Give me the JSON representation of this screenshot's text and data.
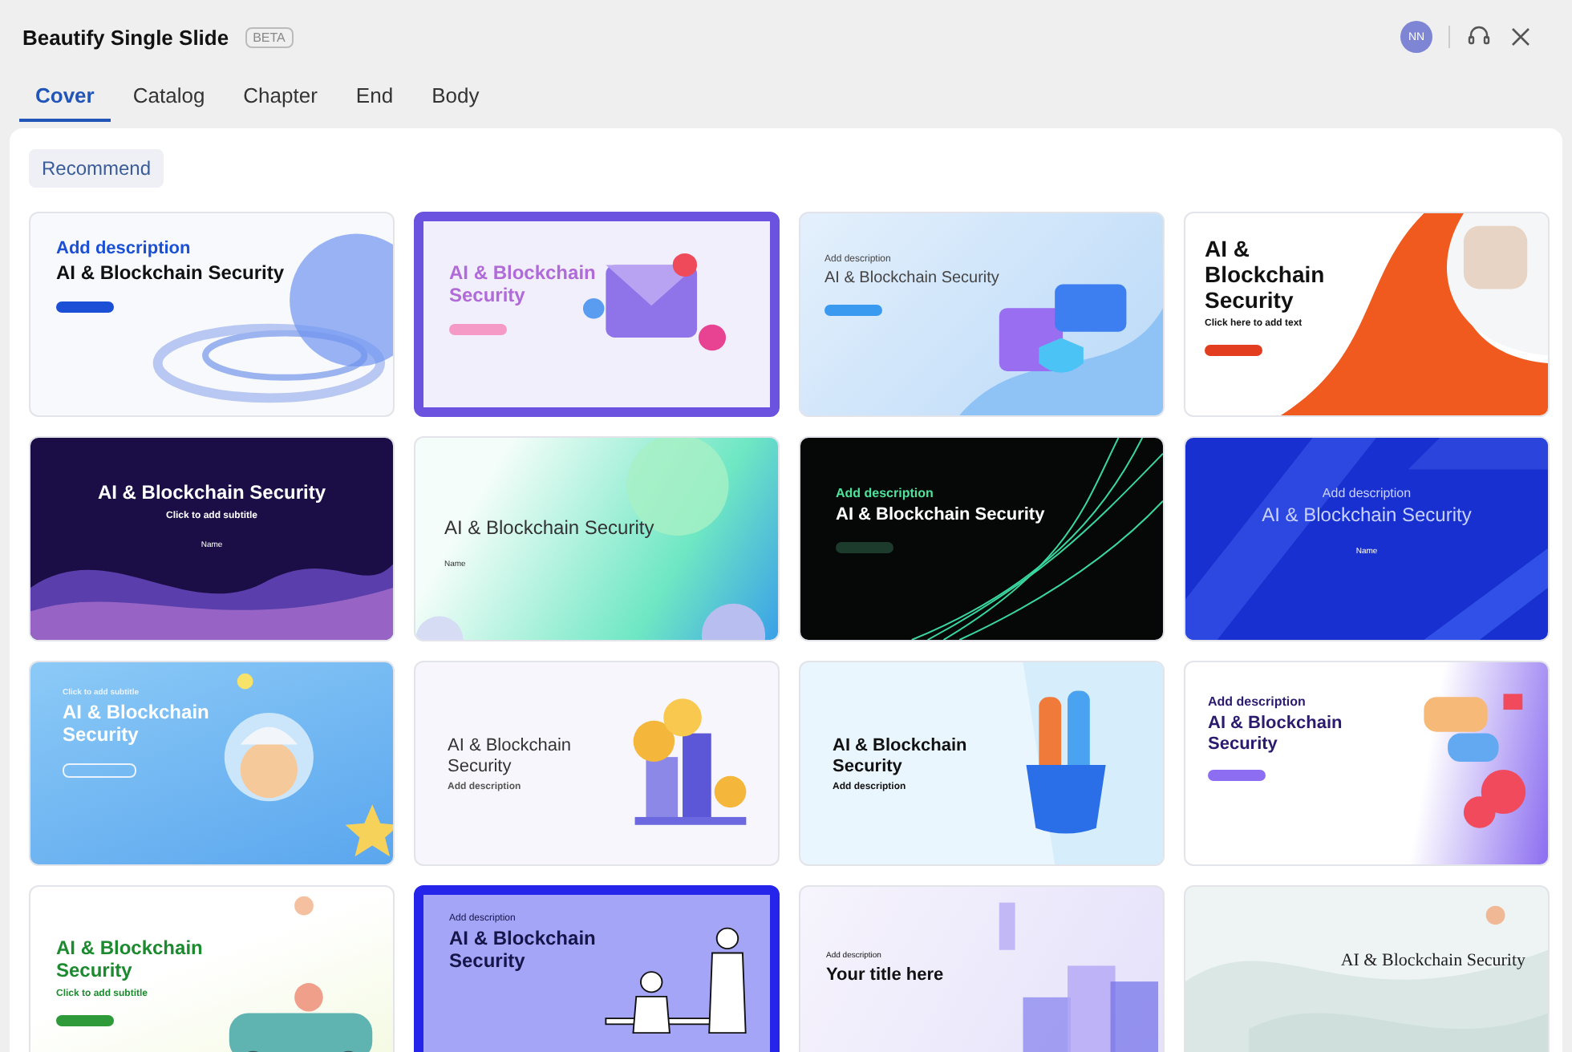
{
  "window": {
    "title": "Beautify Single Slide",
    "badge": "BETA",
    "avatar": "NN"
  },
  "tabs": [
    {
      "label": "Cover",
      "selected": true
    },
    {
      "label": "Catalog",
      "selected": false
    },
    {
      "label": "Chapter",
      "selected": false
    },
    {
      "label": "End",
      "selected": false
    },
    {
      "label": "Body",
      "selected": false
    }
  ],
  "filters": [
    {
      "label": "Recommend",
      "selected": true
    }
  ],
  "slides": [
    {
      "kind": "sphere",
      "eyebrow": "Add description",
      "title": "AI & Blockchain Security"
    },
    {
      "kind": "envelope",
      "title": "AI & Blockchain Security"
    },
    {
      "kind": "bag",
      "eyebrow": "Add description",
      "title": "AI & Blockchain Security"
    },
    {
      "kind": "swoosh",
      "title": "AI & Blockchain Security",
      "subtitle": "Click here to add text"
    },
    {
      "kind": "wave",
      "title": "AI & Blockchain Security",
      "subtitle": "Click to add subtitle",
      "caption": "Name"
    },
    {
      "kind": "glass",
      "title": "AI & Blockchain Security",
      "caption": "Name"
    },
    {
      "kind": "lines",
      "eyebrow": "Add description",
      "title": "AI & Blockchain Security"
    },
    {
      "kind": "blue",
      "eyebrow": "Add description",
      "title": "AI & Blockchain Security",
      "caption": "Name"
    },
    {
      "kind": "kid",
      "eyebrow": "Click to add subtitle",
      "title": "AI & Blockchain Security"
    },
    {
      "kind": "coins",
      "title": "AI & Blockchain Security",
      "subtitle": "Add description"
    },
    {
      "kind": "pencil",
      "title": "AI & Blockchain Security",
      "subtitle": "Add description"
    },
    {
      "kind": "chat",
      "eyebrow": "Add description",
      "title": "AI & Blockchain Security"
    },
    {
      "kind": "green",
      "title": "AI & Blockchain Security",
      "subtitle": "Click to add subtitle"
    },
    {
      "kind": "people",
      "eyebrow": "Add description",
      "title": "AI & Blockchain Security"
    },
    {
      "kind": "cubes",
      "eyebrow": "Add description",
      "title": "Your title here"
    },
    {
      "kind": "mist",
      "title": "AI & Blockchain Security"
    }
  ]
}
